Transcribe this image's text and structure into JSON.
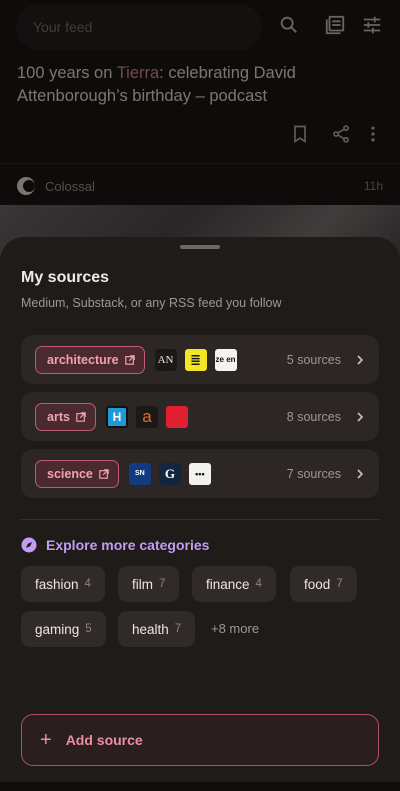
{
  "feed": {
    "search_placeholder": "Your feed",
    "article": {
      "title_before": "100 years on ",
      "title_highlight": "Tierra",
      "title_after": ": celebrating David Attenborough’s birthday – podcast"
    },
    "source_name": "Colossal",
    "time": "11h"
  },
  "sheet": {
    "title": "My sources",
    "subtitle": "Medium, Substack, or any RSS feed you follow",
    "categories": [
      {
        "label": "architecture",
        "count": "5 sources",
        "logos": [
          "AN",
          "≣",
          "ze en"
        ]
      },
      {
        "label": "arts",
        "count": "8 sources",
        "logos": [
          "H",
          "a",
          ""
        ]
      },
      {
        "label": "science",
        "count": "7 sources",
        "logos": [
          "SN",
          "G",
          "•••"
        ]
      }
    ],
    "explore_label": "Explore more categories",
    "tags": [
      {
        "label": "fashion",
        "count": "4"
      },
      {
        "label": "film",
        "count": "7"
      },
      {
        "label": "finance",
        "count": "4"
      },
      {
        "label": "food",
        "count": "7"
      },
      {
        "label": "gaming",
        "count": "5"
      },
      {
        "label": "health",
        "count": "7"
      }
    ],
    "more_label": "+8 more",
    "add_label": "Add source"
  },
  "colors": {
    "accent_pink": "#ec8ea2",
    "accent_purple": "#c29bf2",
    "sheet_bg": "#1f1b19"
  }
}
